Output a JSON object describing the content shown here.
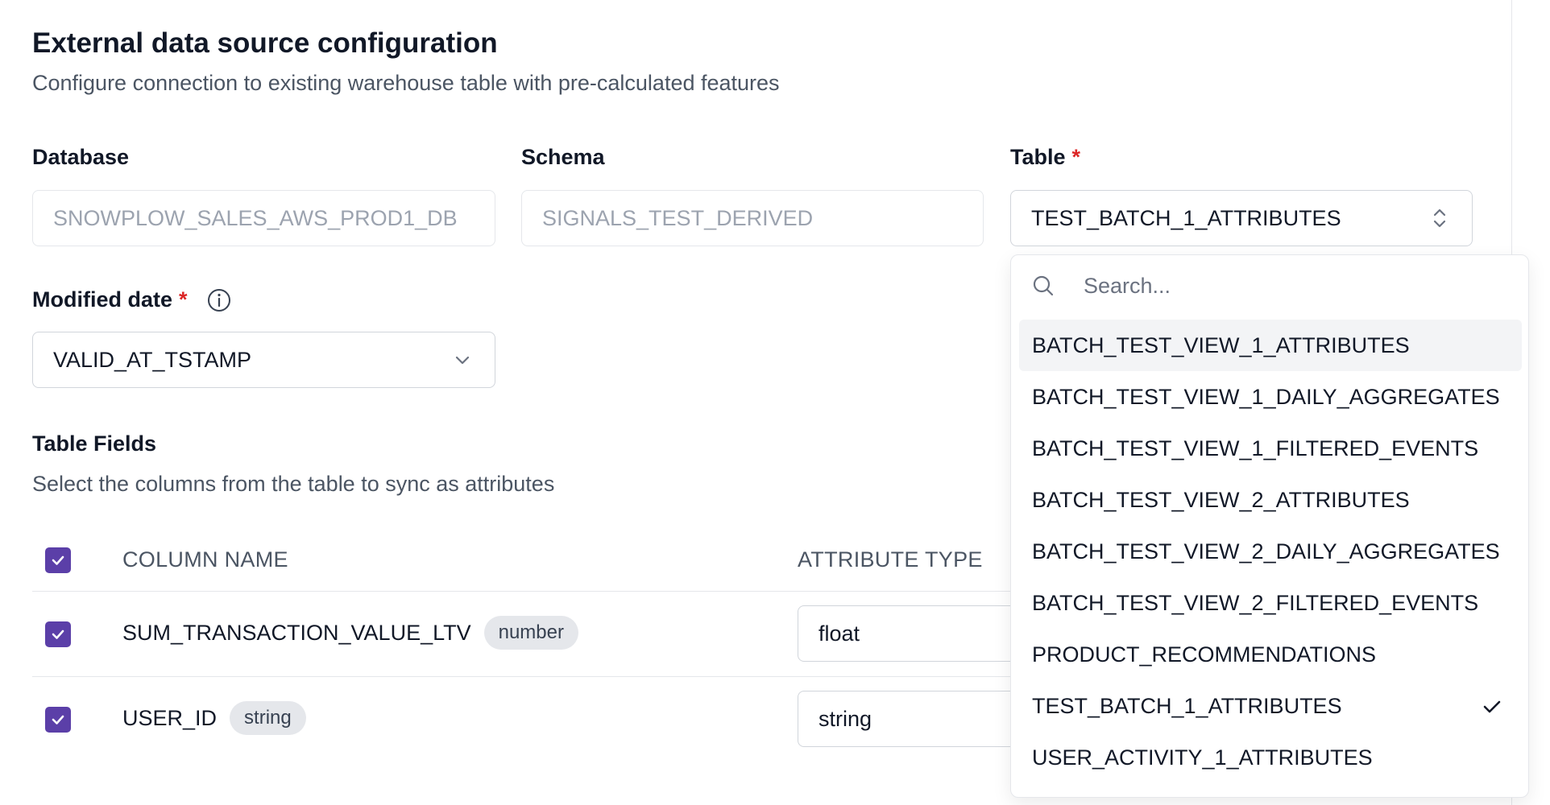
{
  "header": {
    "title": "External data source configuration",
    "subtitle": "Configure connection to existing warehouse table with pre-calculated features"
  },
  "fields": {
    "database": {
      "label": "Database",
      "value": "SNOWPLOW_SALES_AWS_PROD1_DB"
    },
    "schema": {
      "label": "Schema",
      "value": "SIGNALS_TEST_DERIVED"
    },
    "table": {
      "label": "Table",
      "required_mark": "*",
      "value": "TEST_BATCH_1_ATTRIBUTES"
    },
    "modified_date": {
      "label": "Modified date",
      "required_mark": "*",
      "value": "VALID_AT_TSTAMP"
    }
  },
  "table_fields": {
    "title": "Table Fields",
    "description": "Select the columns from the table to sync as attributes",
    "columns": [
      "COLUMN NAME",
      "ATTRIBUTE TYPE"
    ],
    "rows": [
      {
        "name": "SUM_TRANSACTION_VALUE_LTV",
        "source_type": "number",
        "attribute_type": "float",
        "checked": true
      },
      {
        "name": "USER_ID",
        "source_type": "string",
        "attribute_type": "string",
        "checked": true
      }
    ]
  },
  "dropdown": {
    "search_placeholder": "Search...",
    "items": [
      "BATCH_TEST_VIEW_1_ATTRIBUTES",
      "BATCH_TEST_VIEW_1_DAILY_AGGREGATES",
      "BATCH_TEST_VIEW_1_FILTERED_EVENTS",
      "BATCH_TEST_VIEW_2_ATTRIBUTES",
      "BATCH_TEST_VIEW_2_DAILY_AGGREGATES",
      "BATCH_TEST_VIEW_2_FILTERED_EVENTS",
      "PRODUCT_RECOMMENDATIONS",
      "TEST_BATCH_1_ATTRIBUTES",
      "USER_ACTIVITY_1_ATTRIBUTES"
    ],
    "highlighted_item": "BATCH_TEST_VIEW_1_ATTRIBUTES",
    "selected_item": "TEST_BATCH_1_ATTRIBUTES"
  },
  "colors": {
    "accent": "#5b3fa8",
    "required": "#dc2626"
  }
}
